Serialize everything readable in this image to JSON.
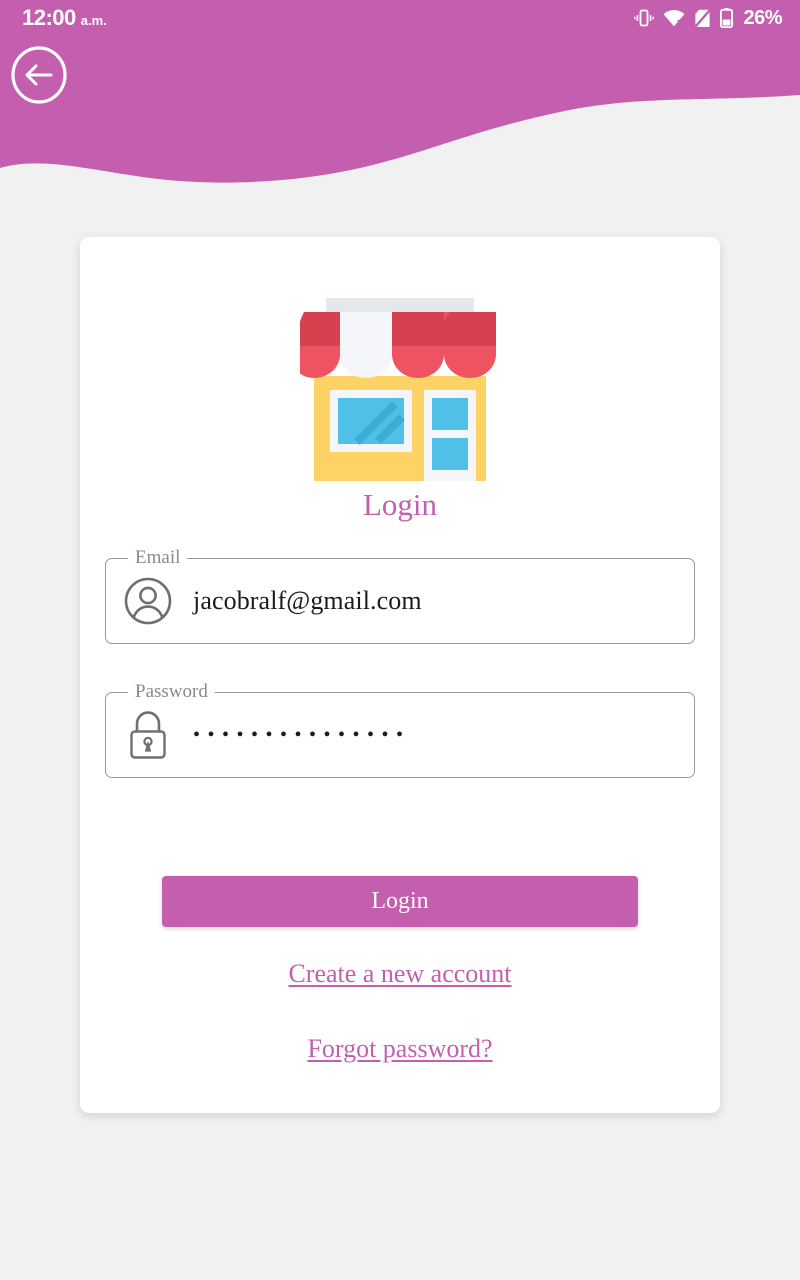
{
  "status_bar": {
    "time": "12:00",
    "ampm": "a.m.",
    "battery_percent": "26%",
    "icons": [
      "vibrate-icon",
      "wifi-icon",
      "no-sim-icon",
      "battery-icon"
    ]
  },
  "header": {
    "back_button": "back-arrow-icon",
    "background_color": "#c45fb0"
  },
  "card": {
    "illustration": "storefront-icon",
    "title": "Login"
  },
  "form": {
    "email": {
      "label": "Email",
      "value": "jacobralf@gmail.com",
      "placeholder": "Email",
      "icon": "account-circle-icon"
    },
    "password": {
      "label": "Password",
      "value": "•••••••••••••••",
      "placeholder": "Password",
      "icon": "lock-icon",
      "masked_char_count": 15
    }
  },
  "actions": {
    "login_button": "Login",
    "create_account_link": "Create a new account",
    "forgot_password_link": "Forgot password?"
  },
  "colors": {
    "accent": "#c45fb0",
    "page_background": "#f1f1f1",
    "card_background": "#ffffff",
    "field_border": "#9b9b9b",
    "label_text": "#8a8a8a",
    "value_text": "#1c1c1c"
  }
}
